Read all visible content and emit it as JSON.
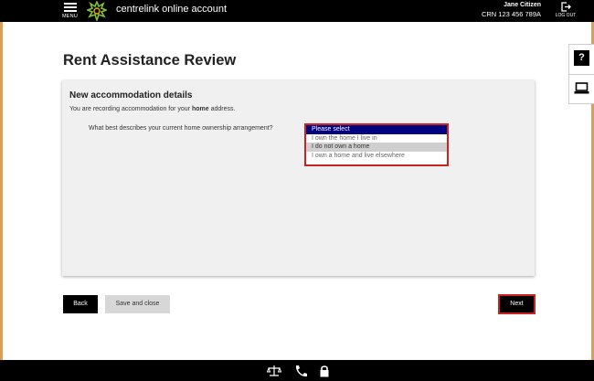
{
  "header": {
    "menu_label": "MENU",
    "brand": "centrelink online account",
    "user_name": "Jane Citizen",
    "crn": "CRN 123 456 789A",
    "logout_label": "LOG OUT"
  },
  "side_tools": {
    "help_label": "?"
  },
  "page": {
    "title": "Rent Assistance Review"
  },
  "panel": {
    "heading": "New accommodation details",
    "sub_prefix": "You are recording accommodation for your ",
    "sub_bold": "home",
    "sub_suffix": " address.",
    "question": "What best describes your current home ownership arrangement?",
    "options": [
      "Please select",
      "I own the home I live in",
      "I do not own a home",
      "I own a home and live elsewhere"
    ]
  },
  "buttons": {
    "back": "Back",
    "save": "Save and close",
    "next": "Next"
  },
  "colors": {
    "header_bg": "#000000",
    "accent_red": "#cc2222",
    "selected_option": "#000080",
    "panel_bg": "#f0f0f0",
    "frame": "#d9a055"
  }
}
